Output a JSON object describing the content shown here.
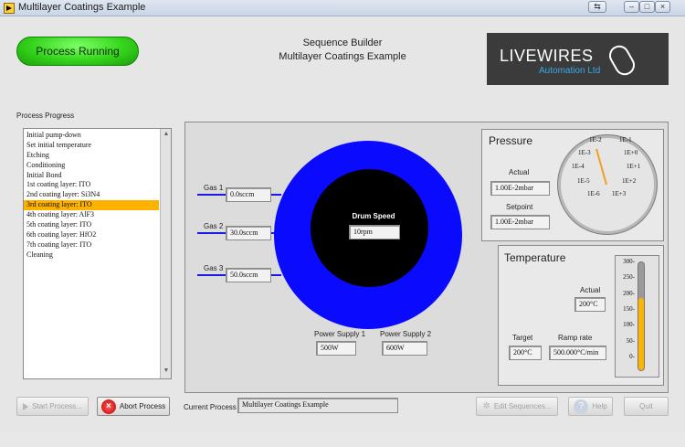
{
  "window": {
    "title": "Multilayer Coatings Example"
  },
  "status": {
    "running_label": "Process Running"
  },
  "header": {
    "line1": "Sequence Builder",
    "line2": "Multilayer Coatings Example"
  },
  "logo": {
    "name": "LIVEWIRES",
    "sub": "Automation Ltd"
  },
  "progress": {
    "label": "Process Progress",
    "items": [
      "Initial pump-down",
      "Set initial temperature",
      "Etching",
      "Conditioning",
      "Initial Bond",
      "1st coating layer: ITO",
      "2nd coating layer: Si3N4",
      "3rd coating layer: ITO",
      "4th coating layer: AlF3",
      "5th coating layer: ITO",
      "6th coating layer: HfO2",
      "7th coating layer: ITO",
      "Cleaning"
    ],
    "selected_index": 7
  },
  "gases": [
    {
      "label": "Gas 1",
      "value": "0.0sccm"
    },
    {
      "label": "Gas 2",
      "value": "30.0sccm"
    },
    {
      "label": "Gas 3",
      "value": "50.0sccm"
    }
  ],
  "drum": {
    "label": "Drum Speed",
    "value": "10rpm"
  },
  "power": [
    {
      "label": "Power Supply 1",
      "value": "500W"
    },
    {
      "label": "Power Supply 2",
      "value": "600W"
    }
  ],
  "pressure": {
    "title": "Pressure",
    "actual_label": "Actual",
    "actual_value": "1.00E-2mbar",
    "setpoint_label": "Setpoint",
    "setpoint_value": "1.00E-2mbar",
    "gauge_labels": [
      "1E-2",
      "1E-1",
      "1E-3",
      "1E+0",
      "1E-4",
      "1E+1",
      "1E-5",
      "1E+2",
      "1E-6",
      "1E+3"
    ]
  },
  "temperature": {
    "title": "Temperature",
    "actual_label": "Actual",
    "actual_value": "200°C",
    "target_label": "Target",
    "target_value": "200°C",
    "ramp_label": "Ramp rate",
    "ramp_value": "500.000°C/min",
    "scale": [
      "300-",
      "250-",
      "200-",
      "150-",
      "100-",
      "50-",
      "0-"
    ],
    "level": 200,
    "max": 300
  },
  "colors": {
    "running": "#34d41b",
    "drum": "#0a0aff",
    "selected": "#ffb100",
    "thermo_fill": "#ffb400"
  },
  "footer": {
    "start_label": "Start Process...",
    "abort_label": "Abort Process",
    "current_label": "Current Process",
    "current_value": "Multilayer Coatings Example",
    "edit_label": "Edit Sequences...",
    "help_label": "Help",
    "quit_label": "Quit"
  }
}
